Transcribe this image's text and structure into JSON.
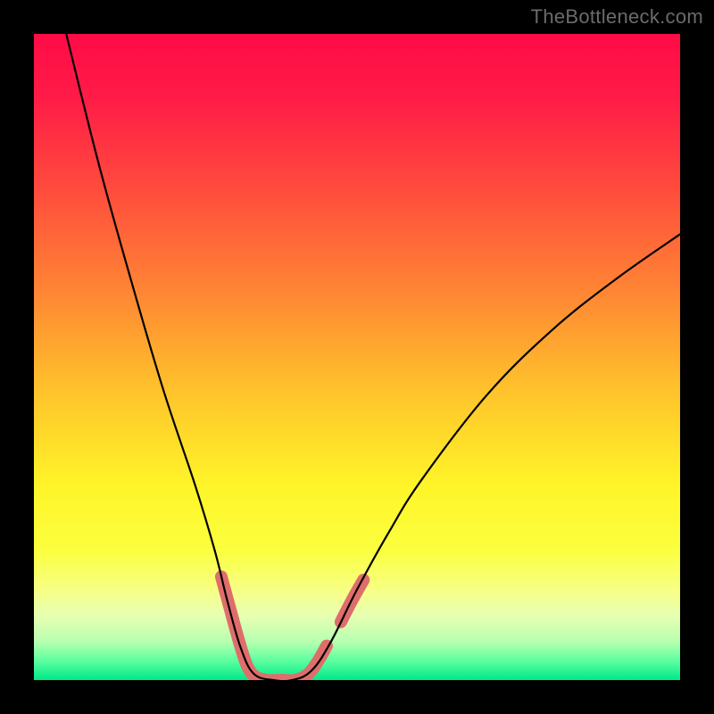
{
  "watermark": {
    "text": "TheBottleneck.com"
  },
  "chart_data": {
    "type": "line",
    "title": "",
    "xlabel": "",
    "ylabel": "",
    "xlim": [
      0,
      100
    ],
    "ylim": [
      0,
      100
    ],
    "grid": false,
    "legend": false,
    "background_gradient": {
      "stops": [
        {
          "offset": 0.0,
          "color": "#ff0b46"
        },
        {
          "offset": 0.1,
          "color": "#ff1c47"
        },
        {
          "offset": 0.25,
          "color": "#ff4f3c"
        },
        {
          "offset": 0.4,
          "color": "#ff8634"
        },
        {
          "offset": 0.55,
          "color": "#ffc22b"
        },
        {
          "offset": 0.7,
          "color": "#fff529"
        },
        {
          "offset": 0.8,
          "color": "#fbff3f"
        },
        {
          "offset": 0.86,
          "color": "#f7ff85"
        },
        {
          "offset": 0.9,
          "color": "#e8ffb2"
        },
        {
          "offset": 0.94,
          "color": "#b8ffb0"
        },
        {
          "offset": 0.97,
          "color": "#5dffa0"
        },
        {
          "offset": 1.0,
          "color": "#00e988"
        }
      ]
    },
    "series": [
      {
        "name": "bottleneck-curve",
        "points": [
          {
            "x": 5.0,
            "y": 100.0
          },
          {
            "x": 10.0,
            "y": 80.0
          },
          {
            "x": 15.0,
            "y": 62.0
          },
          {
            "x": 20.0,
            "y": 45.0
          },
          {
            "x": 25.0,
            "y": 30.0
          },
          {
            "x": 28.0,
            "y": 20.0
          },
          {
            "x": 30.0,
            "y": 12.0
          },
          {
            "x": 32.0,
            "y": 5.0
          },
          {
            "x": 34.0,
            "y": 1.0
          },
          {
            "x": 37.0,
            "y": 0.0
          },
          {
            "x": 40.0,
            "y": 0.0
          },
          {
            "x": 43.0,
            "y": 1.5
          },
          {
            "x": 46.0,
            "y": 6.0
          },
          {
            "x": 50.0,
            "y": 14.0
          },
          {
            "x": 55.0,
            "y": 23.0
          },
          {
            "x": 60.0,
            "y": 31.0
          },
          {
            "x": 70.0,
            "y": 44.0
          },
          {
            "x": 80.0,
            "y": 54.0
          },
          {
            "x": 90.0,
            "y": 62.0
          },
          {
            "x": 100.0,
            "y": 69.0
          }
        ]
      }
    ],
    "highlight_segments": [
      {
        "name": "left-wall-highlight",
        "points": [
          {
            "x": 29.0,
            "y": 16.0
          },
          {
            "x": 30.5,
            "y": 10.5
          },
          {
            "x": 31.8,
            "y": 5.8
          },
          {
            "x": 33.0,
            "y": 2.2
          },
          {
            "x": 34.2,
            "y": 0.6
          },
          {
            "x": 36.0,
            "y": 0.0
          },
          {
            "x": 38.5,
            "y": 0.0
          },
          {
            "x": 40.5,
            "y": 0.0
          },
          {
            "x": 42.5,
            "y": 1.0
          },
          {
            "x": 44.0,
            "y": 3.0
          },
          {
            "x": 45.3,
            "y": 5.3
          }
        ]
      },
      {
        "name": "right-wall-highlight",
        "points": [
          {
            "x": 47.5,
            "y": 9.0
          },
          {
            "x": 49.2,
            "y": 12.3
          },
          {
            "x": 51.0,
            "y": 15.5
          }
        ]
      }
    ],
    "highlight_style": {
      "color": "#de6e6b",
      "width": 14,
      "cap": "round"
    },
    "curve_style": {
      "color": "#000000",
      "width": 2.2
    }
  }
}
